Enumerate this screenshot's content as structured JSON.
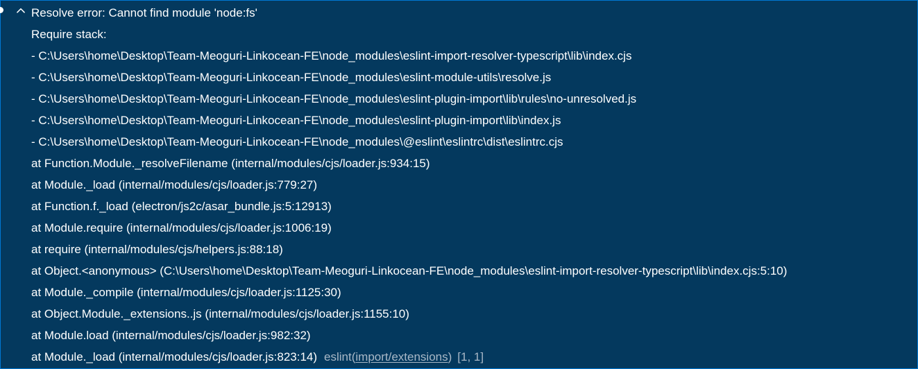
{
  "error": {
    "title": "Resolve error: Cannot find module 'node:fs'",
    "lines": [
      "Require stack:",
      "- C:\\Users\\home\\Desktop\\Team-Meoguri-Linkocean-FE\\node_modules\\eslint-import-resolver-typescript\\lib\\index.cjs",
      "- C:\\Users\\home\\Desktop\\Team-Meoguri-Linkocean-FE\\node_modules\\eslint-module-utils\\resolve.js",
      "- C:\\Users\\home\\Desktop\\Team-Meoguri-Linkocean-FE\\node_modules\\eslint-plugin-import\\lib\\rules\\no-unresolved.js",
      "- C:\\Users\\home\\Desktop\\Team-Meoguri-Linkocean-FE\\node_modules\\eslint-plugin-import\\lib\\index.js",
      "- C:\\Users\\home\\Desktop\\Team-Meoguri-Linkocean-FE\\node_modules\\@eslint\\eslintrc\\dist\\eslintrc.cjs",
      "at Function.Module._resolveFilename (internal/modules/cjs/loader.js:934:15)",
      "at Module._load (internal/modules/cjs/loader.js:779:27)",
      "at Function.f._load (electron/js2c/asar_bundle.js:5:12913)",
      "at Module.require (internal/modules/cjs/loader.js:1006:19)",
      "at require (internal/modules/cjs/helpers.js:88:18)",
      "at Object.<anonymous> (C:\\Users\\home\\Desktop\\Team-Meoguri-Linkocean-FE\\node_modules\\eslint-import-resolver-typescript\\lib\\index.cjs:5:10)",
      "at Module._compile (internal/modules/cjs/loader.js:1125:30)",
      "at Object.Module._extensions..js (internal/modules/cjs/loader.js:1155:10)",
      "at Module.load (internal/modules/cjs/loader.js:982:32)"
    ],
    "last_line": "at Module._load (internal/modules/cjs/loader.js:823:14)",
    "source": "eslint",
    "code_open": "(",
    "code": "import/extensions",
    "code_close": ")",
    "position": "[1, 1]"
  },
  "colors": {
    "background": "#04395e",
    "border": "#0078d4",
    "text": "#ffffff",
    "muted": "#a9b8c7"
  },
  "icons": {
    "expand": "chevron-up-icon",
    "status": "status-dot-icon"
  }
}
